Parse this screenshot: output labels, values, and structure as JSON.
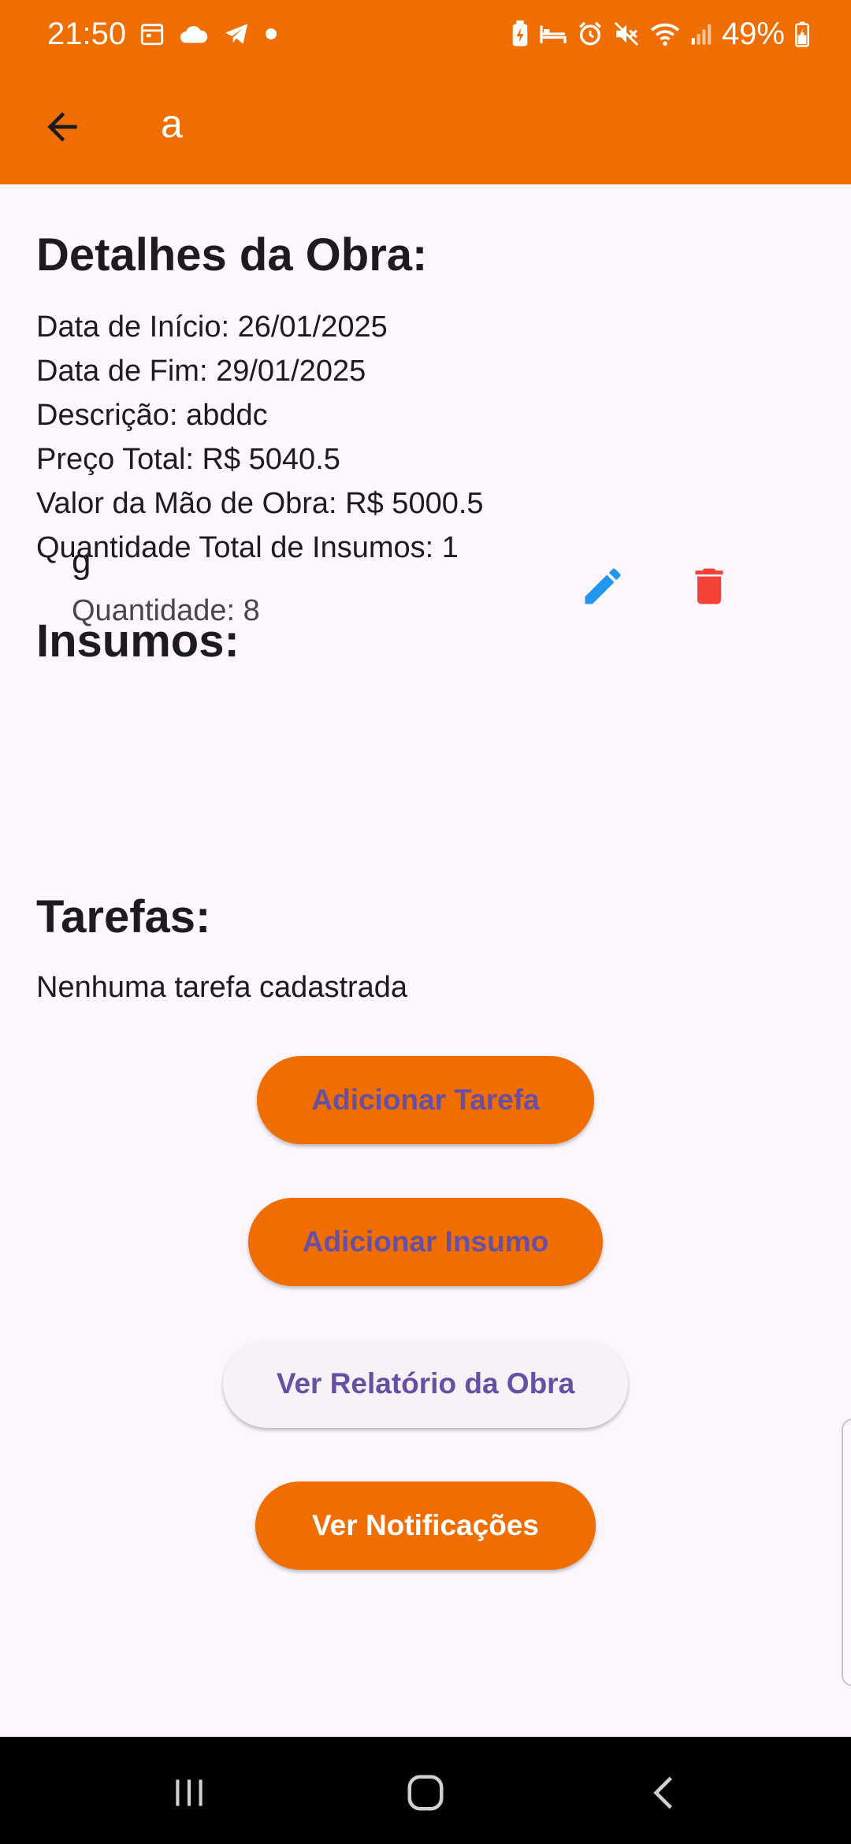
{
  "status_bar": {
    "time": "21:50",
    "battery": "49%",
    "left_icons": [
      "calendar-icon",
      "cloud-icon",
      "telegram-icon",
      "dot-icon"
    ],
    "right_icons": [
      "battery-saver-icon",
      "bed-icon",
      "alarm-icon",
      "mute-icon",
      "wifi-icon",
      "signal-icon",
      "battery-charging-icon"
    ]
  },
  "app_bar": {
    "title": "a",
    "back_icon": "arrow-back-icon"
  },
  "details": {
    "heading": "Detalhes da Obra:",
    "lines": [
      "Data de Início: 26/01/2025",
      "Data de Fim: 29/01/2025",
      "Descrição: abddc",
      "Preço Total: R$ 5040.5",
      "Valor da Mão de Obra: R$ 5000.5",
      "Quantidade Total de Insumos: 1"
    ]
  },
  "insumos": {
    "heading": "Insumos:",
    "items": [
      {
        "name": "g",
        "quantity": "Quantidade: 8",
        "edit_icon": "pencil-icon",
        "delete_icon": "trash-icon"
      }
    ]
  },
  "tarefas": {
    "heading": "Tarefas:",
    "empty_text": "Nenhuma tarefa cadastrada"
  },
  "buttons": {
    "add_task": "Adicionar Tarefa",
    "add_insumo": "Adicionar Insumo",
    "report": "Ver Relatório da Obra",
    "notifications": "Ver Notificações"
  },
  "colors": {
    "primary": "#F06D00",
    "button_text": "#6750A4",
    "edit_icon": "#2196F3",
    "delete_icon": "#F44336",
    "background": "#FDF7FD"
  },
  "nav_bar": {
    "icons": [
      "recent-apps-icon",
      "home-icon",
      "back-icon"
    ]
  }
}
